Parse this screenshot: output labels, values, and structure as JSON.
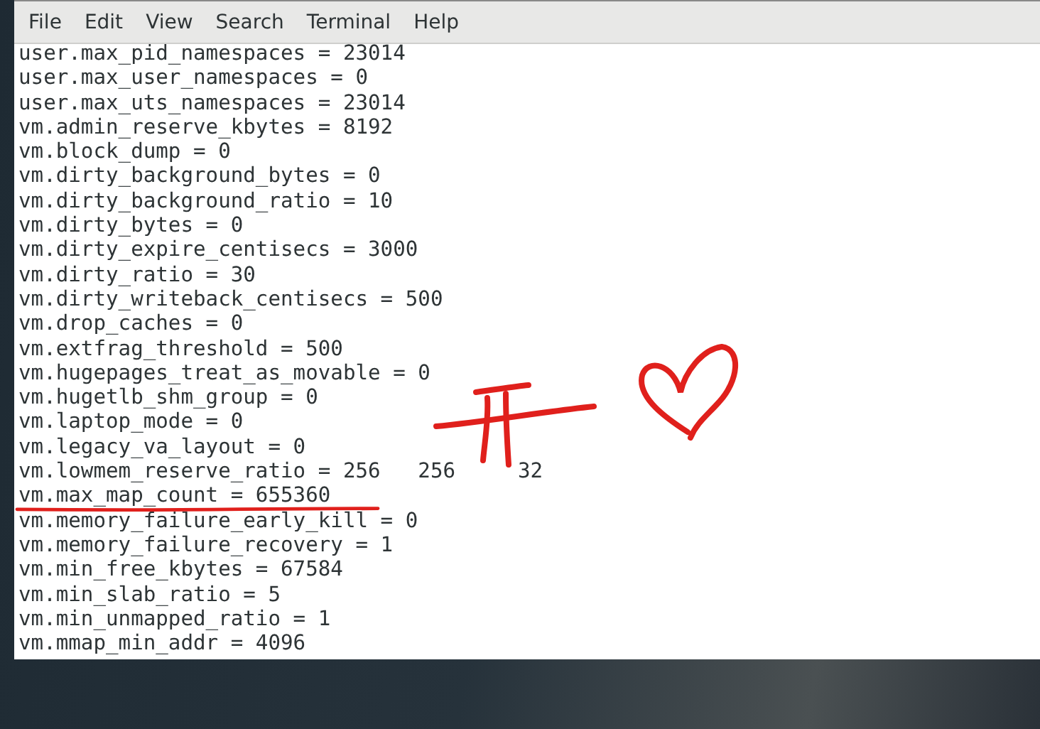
{
  "menu": [
    "File",
    "Edit",
    "View",
    "Search",
    "Terminal",
    "Help"
  ],
  "terminal_lines": [
    "user.max_pid_namespaces = 23014",
    "user.max_user_namespaces = 0",
    "user.max_uts_namespaces = 23014",
    "vm.admin_reserve_kbytes = 8192",
    "vm.block_dump = 0",
    "vm.dirty_background_bytes = 0",
    "vm.dirty_background_ratio = 10",
    "vm.dirty_bytes = 0",
    "vm.dirty_expire_centisecs = 3000",
    "vm.dirty_ratio = 30",
    "vm.dirty_writeback_centisecs = 500",
    "vm.drop_caches = 0",
    "vm.extfrag_threshold = 500",
    "vm.hugepages_treat_as_movable = 0",
    "vm.hugetlb_shm_group = 0",
    "vm.laptop_mode = 0",
    "vm.legacy_va_layout = 0",
    "vm.lowmem_reserve_ratio = 256   256     32",
    "vm.max_map_count = 655360",
    "vm.memory_failure_early_kill = 0",
    "vm.memory_failure_recovery = 1",
    "vm.min_free_kbytes = 67584",
    "vm.min_slab_ratio = 5",
    "vm.min_unmapped_ratio = 1",
    "vm.mmap_min_addr = 4096"
  ]
}
